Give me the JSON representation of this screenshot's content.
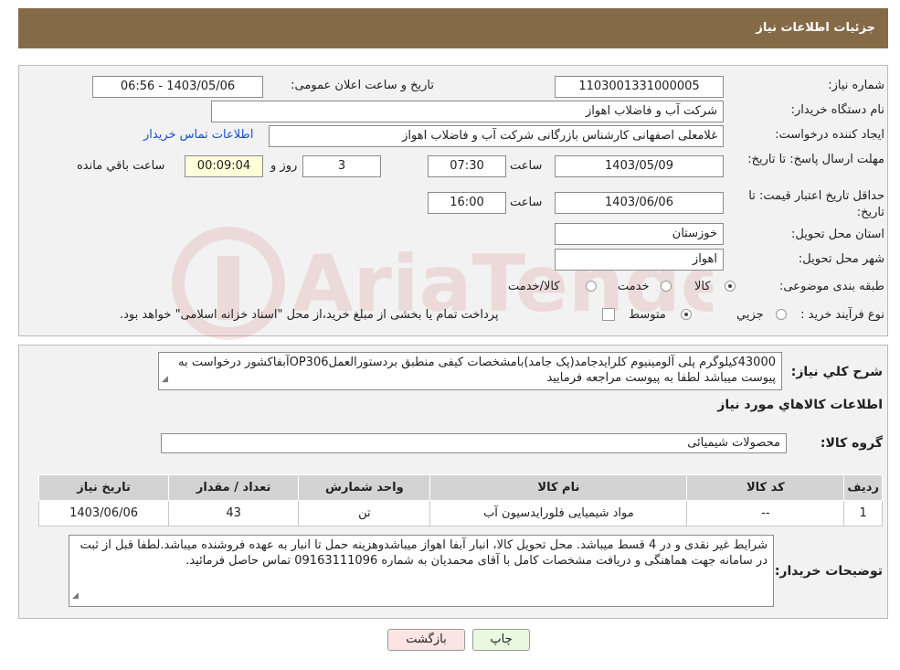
{
  "header": {
    "title": "جزئیات اطلاعات نیاز"
  },
  "watermark": {
    "text": "AriaTender.neT"
  },
  "form": {
    "need_number": {
      "label": "شماره نیاز:",
      "value": "1103001331000005"
    },
    "announce_datetime": {
      "label": "تاریخ و ساعت اعلان عمومی:",
      "value": "1403/05/06 - 06:56"
    },
    "buyer_org": {
      "label": "نام دستگاه خریدار:",
      "value": "شرکت آب و فاضلاب اهواز"
    },
    "requester": {
      "label": "ایجاد کننده درخواست:",
      "value": "غلامعلی اصفهانی کارشناس بازرگانی شرکت آب و فاضلاب اهواز",
      "contact_link": "اطلاعات تماس خریدار"
    },
    "reply_deadline": {
      "label": "مهلت ارسال پاسخ: تا تاریخ:",
      "date": "1403/05/09",
      "time_label": "ساعت",
      "time": "07:30",
      "days": "3",
      "days_label": "روز و",
      "remaining": "00:09:04",
      "remaining_label": "ساعت باقي مانده"
    },
    "price_validity": {
      "label": "حداقل تاریخ اعتبار قیمت: تا تاریخ:",
      "date": "1403/06/06",
      "time_label": "ساعت",
      "time": "16:00"
    },
    "province": {
      "label": "استان محل تحویل:",
      "value": "خوزستان"
    },
    "city": {
      "label": "شهر محل تحویل:",
      "value": "اهواز"
    },
    "category": {
      "label": "طبقه بندی موضوعی:",
      "options": [
        "کالا",
        "خدمت",
        "کالا/خدمت"
      ],
      "selected": "کالا"
    },
    "purchase_type": {
      "label": "نوع فرآیند خرید :",
      "options": [
        "جزیي",
        "متوسط"
      ],
      "selected": "متوسط",
      "note": "پرداخت تمام یا بخشی از مبلغ خرید،از محل \"اسناد خزانه اسلامی\" خواهد بود."
    }
  },
  "details": {
    "description": {
      "label": "شرح کلي نياز:",
      "value": "43000کیلوگرم پلی آلومینیوم کلرایدجامد(پک جامد)بامشخصات کیفی منطبق بردستورالعملOP306آبفاکشور درخواست به پیوست میباشد لطفا به پیوست مراجعه فرمایید"
    },
    "goods_info_title": "اطلاعات کالاهاي مورد نياز",
    "goods_group": {
      "label": "گروه کالا:",
      "value": "محصولات شیمیائی"
    },
    "table": {
      "headers": [
        "رديف",
        "کد کالا",
        "نام کالا",
        "واحد شمارش",
        "تعداد / مقدار",
        "تاریخ نیاز"
      ],
      "rows": [
        [
          "1",
          "--",
          "مواد شیمیایی فلورایدسیون آب",
          "تن",
          "43",
          "1403/06/06"
        ]
      ]
    },
    "buyer_notes": {
      "label": "توضیحات خریدار:",
      "value": "شرایط غیر نقدی و در 4 قسط میباشد. محل تحویل کالا، انبار آبفا اهواز میباشدوهزینه حمل تا انبار به عهده فروشنده میباشد.لطفا قبل از ثبت در سامانه جهت هماهنگی و دریافت مشخصات کامل با آقای  محمدیان به شماره 09163111096 تماس حاصل فرمائید."
    }
  },
  "buttons": {
    "print": "چاپ",
    "back": "بازگشت"
  },
  "colors": {
    "header_bg": "#856a48",
    "panel_bg": "#f2f2f2",
    "back_button_bg": "#fde4e4",
    "print_button_bg": "#eaf8e0"
  }
}
